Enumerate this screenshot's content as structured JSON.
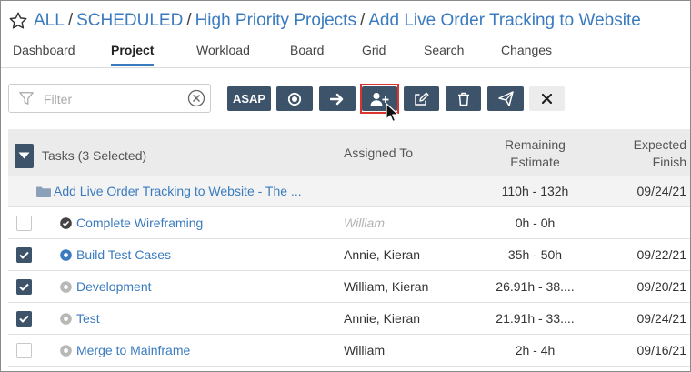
{
  "breadcrumb": {
    "items": [
      "ALL",
      "SCHEDULED",
      "High Priority Projects",
      "Add Live Order Tracking to Website"
    ],
    "separator": "/"
  },
  "tabs": [
    "Dashboard",
    "Project",
    "Workload",
    "Board",
    "Grid",
    "Search",
    "Changes"
  ],
  "active_tab": "Project",
  "filter": {
    "placeholder": "Filter",
    "value": ""
  },
  "toolbar": {
    "asap_label": "ASAP",
    "buttons": [
      "asap",
      "priority-dot",
      "move-arrow",
      "assign-user",
      "edit",
      "delete",
      "send",
      "close"
    ],
    "highlighted_button": "assign-user"
  },
  "table": {
    "headers": {
      "tasks": "Tasks (3 Selected)",
      "assigned": "Assigned To",
      "estimate_line1": "Remaining",
      "estimate_line2": "Estimate",
      "finish_line1": "Expected",
      "finish_line2": "Finish"
    },
    "group": {
      "name": "Add Live Order Tracking to Website - The ...",
      "estimate": "110h - 132h",
      "finish": "09/24/21"
    },
    "rows": [
      {
        "name": "Complete Wireframing",
        "assigned": "William",
        "estimate": "0h - 0h",
        "finish": "",
        "checked": false,
        "status": "done"
      },
      {
        "name": "Build Test Cases",
        "assigned": "Annie, Kieran",
        "estimate": "35h - 50h",
        "finish": "09/22/21",
        "checked": true,
        "status": "in-progress"
      },
      {
        "name": "Development",
        "assigned": "William, Kieran",
        "estimate": "26.91h - 38....",
        "finish": "09/20/21",
        "checked": true,
        "status": "pending"
      },
      {
        "name": "Test",
        "assigned": "Annie, Kieran",
        "estimate": "21.91h - 33....",
        "finish": "09/24/21",
        "checked": true,
        "status": "pending"
      },
      {
        "name": "Merge to Mainframe",
        "assigned": "William",
        "estimate": "2h - 4h",
        "finish": "09/16/21",
        "checked": false,
        "status": "pending"
      }
    ]
  },
  "colors": {
    "link": "#3a7bbf",
    "toolbar_button": "#3d5369",
    "highlight": "#d9352e",
    "header_bg": "#ebebeb"
  }
}
